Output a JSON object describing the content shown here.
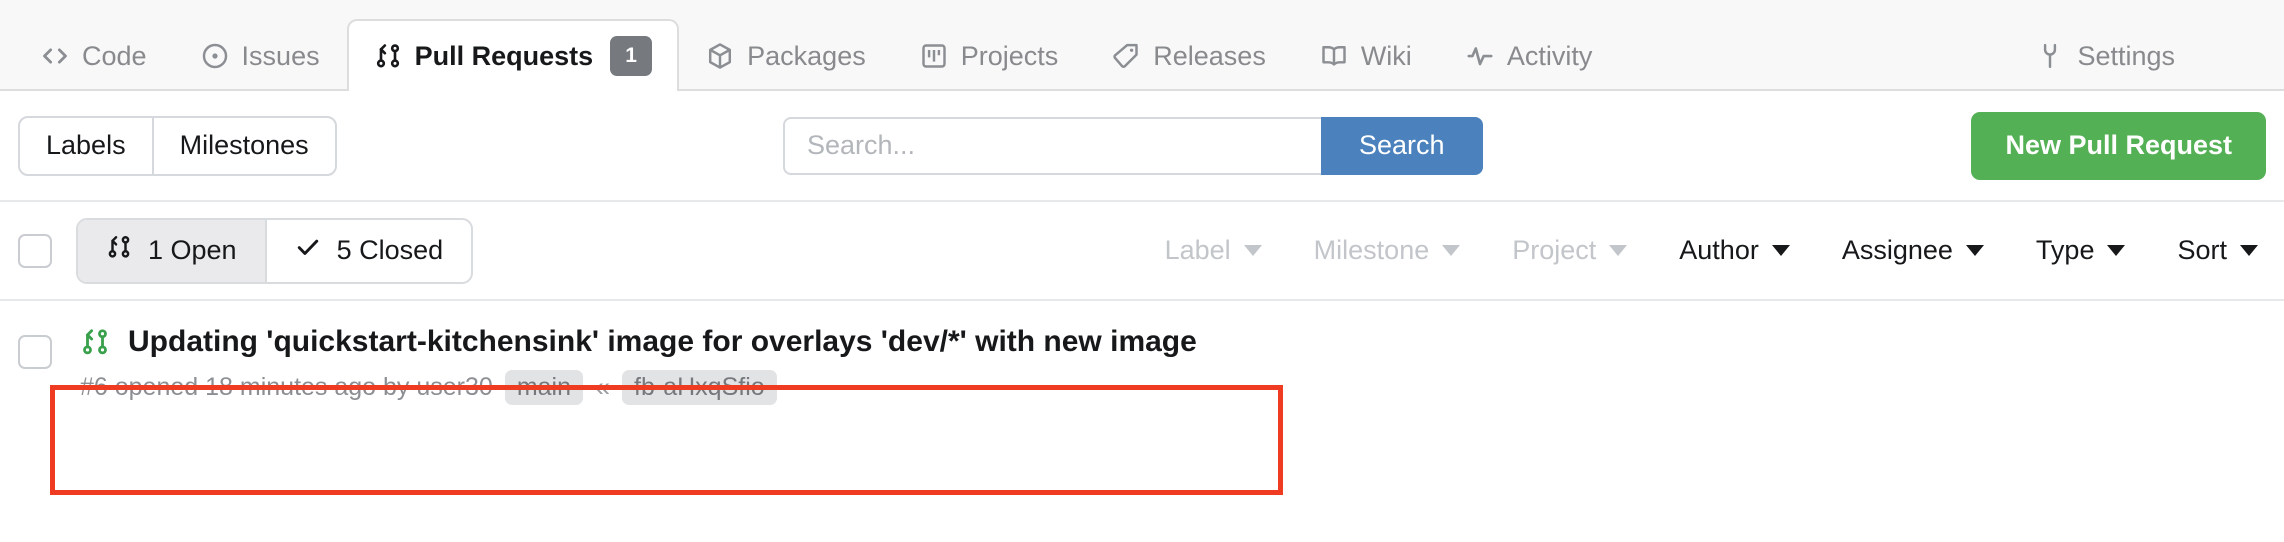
{
  "nav": {
    "tabs": [
      {
        "label": "Code",
        "icon": "code-icon",
        "active": false
      },
      {
        "label": "Issues",
        "icon": "issue-opened-icon",
        "active": false
      },
      {
        "label": "Pull Requests",
        "icon": "git-pull-request-icon",
        "active": true,
        "count": "1"
      },
      {
        "label": "Packages",
        "icon": "package-icon",
        "active": false
      },
      {
        "label": "Projects",
        "icon": "project-icon",
        "active": false
      },
      {
        "label": "Releases",
        "icon": "tag-icon",
        "active": false
      },
      {
        "label": "Wiki",
        "icon": "book-icon",
        "active": false
      },
      {
        "label": "Activity",
        "icon": "pulse-icon",
        "active": false
      }
    ],
    "settings_tab": {
      "label": "Settings",
      "icon": "wrench-icon"
    }
  },
  "toolbar": {
    "labels_button": "Labels",
    "milestones_button": "Milestones",
    "search": {
      "value": "",
      "placeholder": "Search..."
    },
    "search_button": "Search",
    "new_pull_request_button": "New Pull Request"
  },
  "filterbar": {
    "open_state": {
      "label": "1 Open",
      "icon": "git-pull-request-icon",
      "selected": true
    },
    "closed_state": {
      "label": "5 Closed",
      "icon": "check-icon",
      "selected": false
    },
    "dropdowns": [
      {
        "label": "Label",
        "disabled": true
      },
      {
        "label": "Milestone",
        "disabled": true
      },
      {
        "label": "Project",
        "disabled": true
      },
      {
        "label": "Author",
        "disabled": false
      },
      {
        "label": "Assignee",
        "disabled": false
      },
      {
        "label": "Type",
        "disabled": false
      },
      {
        "label": "Sort",
        "disabled": false
      }
    ]
  },
  "pull_requests": [
    {
      "icon": "git-pull-request-icon",
      "title": "Updating 'quickstart-kitchensink' image for overlays 'dev/*' with new image",
      "meta": "#6 opened 18 minutes ago by user30",
      "base_branch": "main",
      "arrow": "«",
      "head_branch": "fb-aHxqSfio"
    }
  ],
  "annotation": {
    "highlight_color": "#ee3b21"
  },
  "colors": {
    "search_button": "#4b82bd",
    "new_pr_button": "#54b055",
    "pr_icon_green": "#39a04b",
    "counter_badge": "#767a7e"
  }
}
